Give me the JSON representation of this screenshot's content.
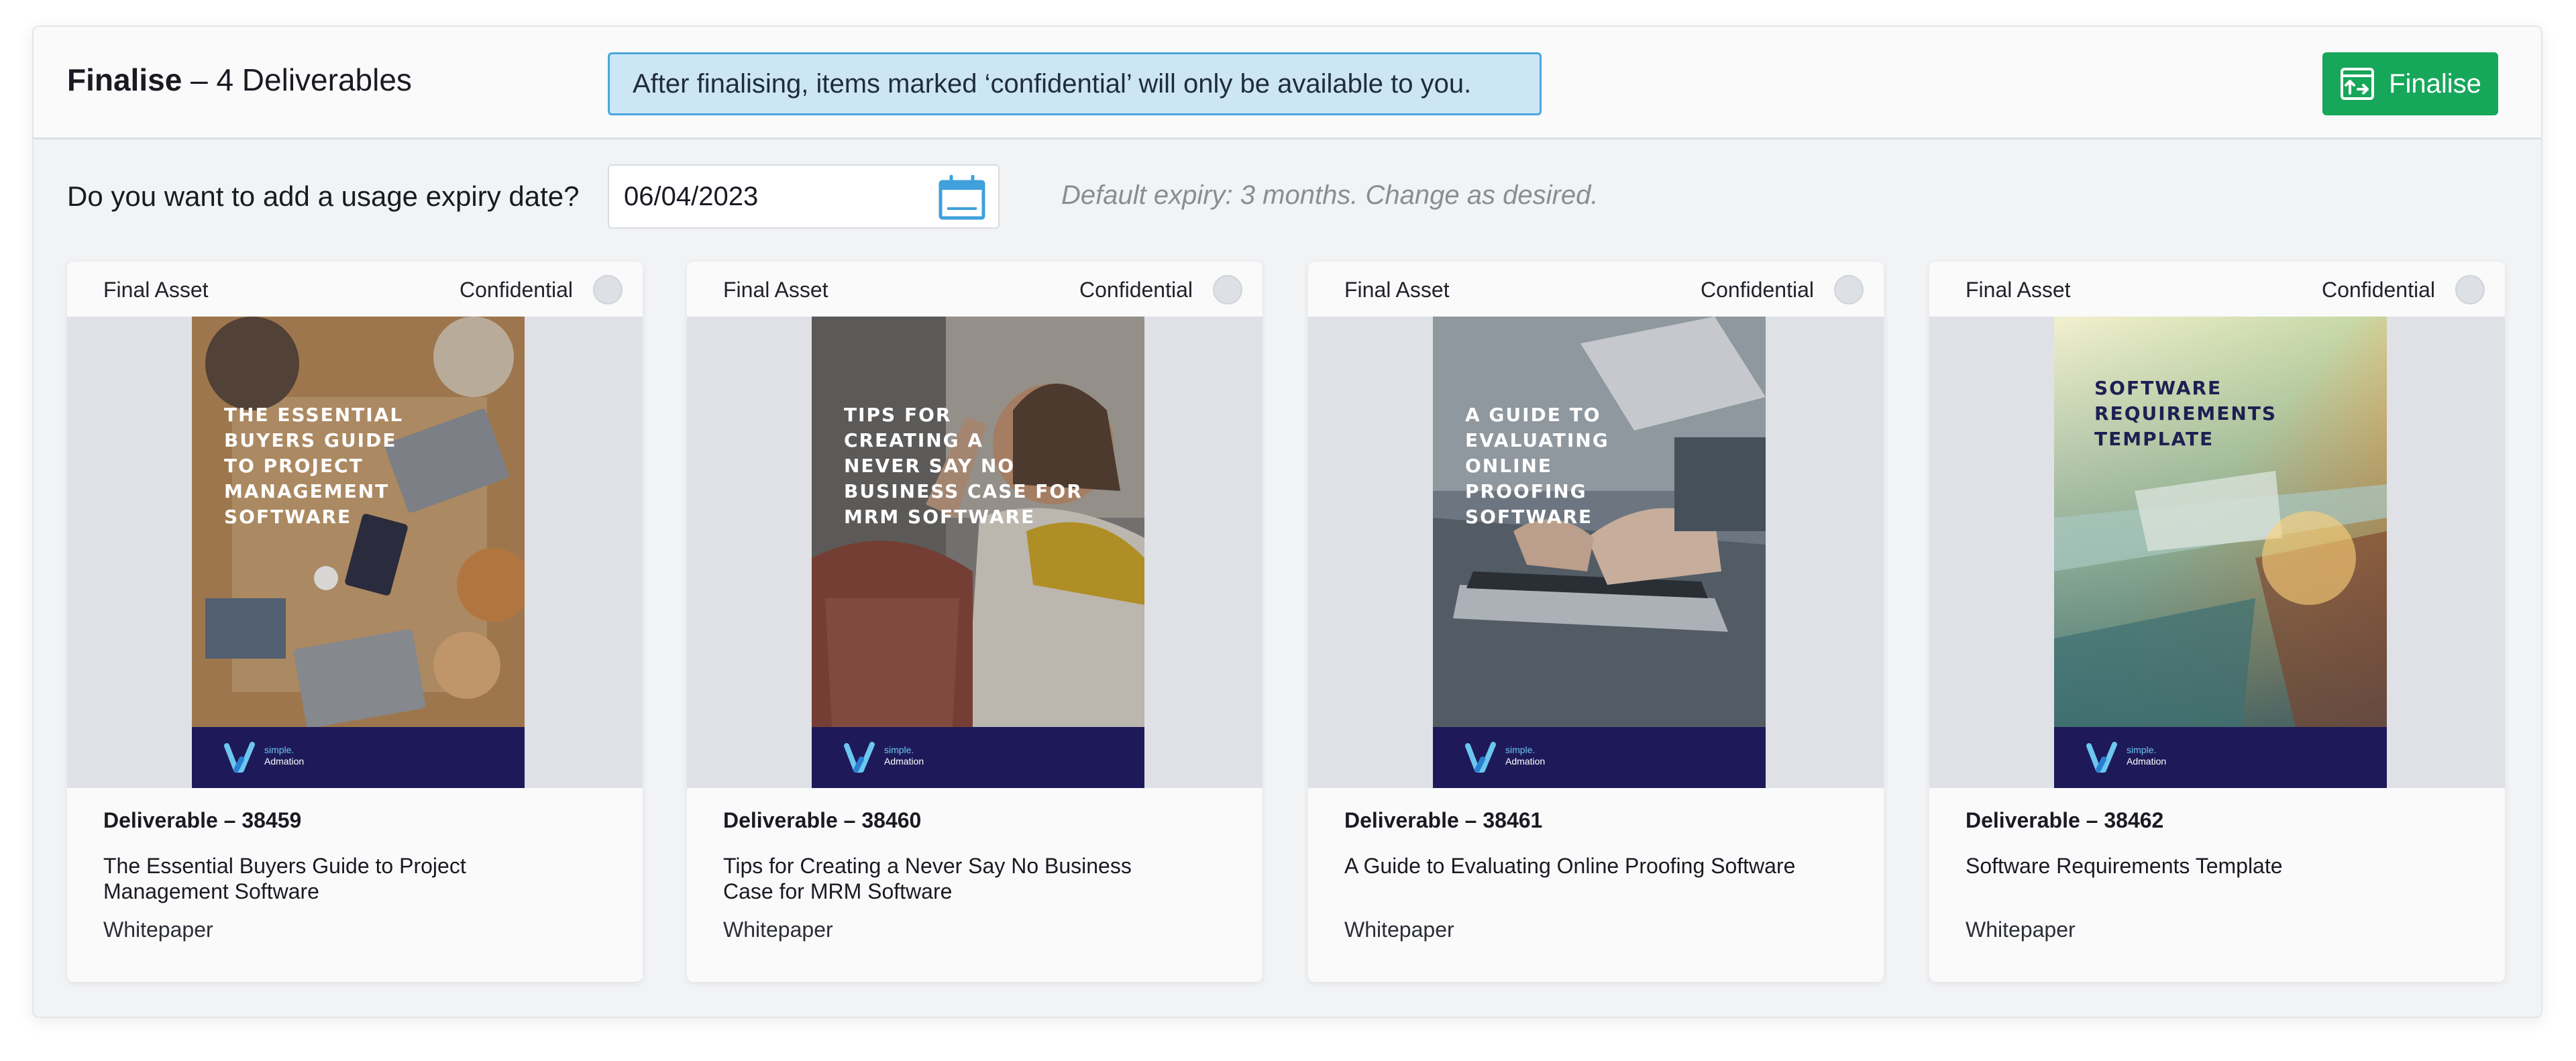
{
  "header": {
    "title_bold": "Finalise",
    "title_rest": " – 4 Deliverables",
    "notice": "After finalising, items marked ‘confidential’ will only be available to you.",
    "finalise_label": "Finalise"
  },
  "expiry": {
    "label": "Do you want to add a usage expiry date?",
    "date_value": "06/04/2023",
    "hint": "Default expiry: 3 months. Change as desired."
  },
  "colors": {
    "accent_green": "#16a75a",
    "notice_blue": "#cde6f6",
    "cover_navy": "#1e1a59"
  },
  "cards": [
    {
      "asset_label": "Final Asset",
      "confidential_label": "Confidential",
      "cover_title": "THE ESSENTIAL\nBUYERS GUIDE\nTO PROJECT\nMANAGEMENT\nSOFTWARE",
      "logo_line1": "simple.",
      "logo_line2": "Admation",
      "deliverable_id": "Deliverable – 38459",
      "name": "The Essential Buyers Guide to Project\nManagement Software",
      "type": "Whitepaper"
    },
    {
      "asset_label": "Final Asset",
      "confidential_label": "Confidential",
      "cover_title": "TIPS FOR\nCREATING A\nNEVER SAY NO\nBUSINESS CASE FOR\nMRM SOFTWARE",
      "logo_line1": "simple.",
      "logo_line2": "Admation",
      "deliverable_id": "Deliverable – 38460",
      "name": "Tips for Creating a Never Say No Business\nCase for MRM Software",
      "type": "Whitepaper"
    },
    {
      "asset_label": "Final Asset",
      "confidential_label": "Confidential",
      "cover_title": "A GUIDE TO\nEVALUATING\nONLINE\nPROOFING\nSOFTWARE",
      "logo_line1": "simple.",
      "logo_line2": "Admation",
      "deliverable_id": "Deliverable – 38461",
      "name": "A Guide to Evaluating Online Proofing Software",
      "type": "Whitepaper"
    },
    {
      "asset_label": "Final Asset",
      "confidential_label": "Confidential",
      "cover_title": "SOFTWARE\nREQUIREMENTS\nTEMPLATE",
      "logo_line1": "simple.",
      "logo_line2": "Admation",
      "deliverable_id": "Deliverable – 38462",
      "name": "Software Requirements Template",
      "type": "Whitepaper"
    }
  ]
}
